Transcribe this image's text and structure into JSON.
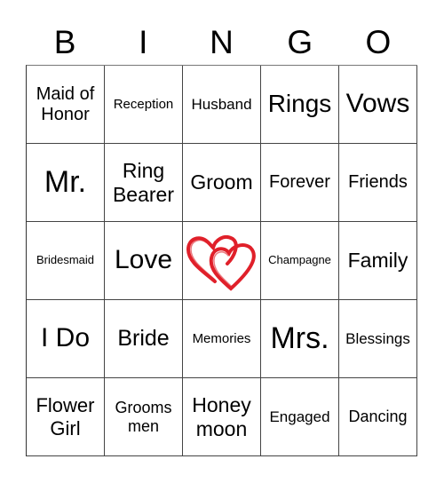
{
  "header": [
    "B",
    "I",
    "N",
    "G",
    "O"
  ],
  "cells": [
    [
      "Maid of Honor",
      "Reception",
      "Husband",
      "Rings",
      "Vows"
    ],
    [
      "Mr.",
      "Ring Bearer",
      "Groom",
      "Forever",
      "Friends"
    ],
    [
      "Bridesmaid",
      "Love",
      "",
      "Champagne",
      "Family"
    ],
    [
      "I Do",
      "Bride",
      "Memories",
      "Mrs.",
      "Blessings"
    ],
    [
      "Flower Girl",
      "Grooms men",
      "Honey moon",
      "Engaged",
      "Dancing"
    ]
  ],
  "free_space": {
    "icon": "double-hearts-icon",
    "color": "#e0202a"
  }
}
